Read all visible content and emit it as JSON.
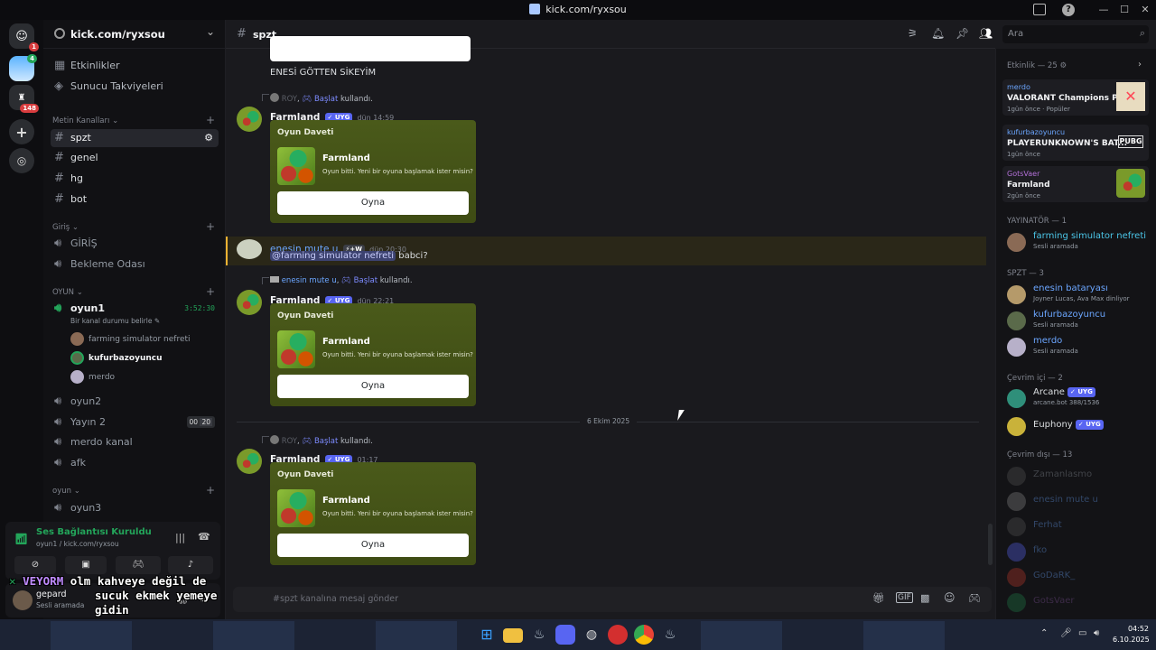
{
  "window": {
    "title": "kick.com/ryxsou",
    "min": "—",
    "max": "☐",
    "close": "✕"
  },
  "guild": {
    "name": "kick.com/ryxsou"
  },
  "sidebar_top": [
    "Etkinlikler",
    "Sunucu Takviyeleri"
  ],
  "categories": {
    "metin": "Metin Kanalları",
    "giris": "Giriş",
    "oyun_upper": "OYUN",
    "oyun_lower": "oyun"
  },
  "text_channels": [
    "spzt",
    "genel",
    "hg",
    "bot"
  ],
  "giris_channels": [
    "GİRİŞ",
    "Bekleme Odası"
  ],
  "voice": {
    "oyun1": {
      "name": "oyun1",
      "timer": "3:52:30",
      "status": "Bir kanal durumu belirle",
      "users": [
        "farming simulator nefreti",
        "kufurbazoyuncu",
        "merdo"
      ]
    },
    "others": [
      "oyun2",
      "Yayın 2",
      "merdo kanal",
      "afk"
    ],
    "yayin_counts": [
      "00",
      "20"
    ],
    "oyun3": "oyun3"
  },
  "voice_bar": {
    "title": "Ses Bağlantısı Kuruldu",
    "sub": "oyun1 / kick.com/ryxsou"
  },
  "user_panel": {
    "name": "gepard",
    "status": "Sesli aramada"
  },
  "stream_overlay": {
    "tag": "VEYORM",
    "line1": "olm kahveye değil de",
    "line2": "sucuk ekmek yemeye",
    "line3": "gidin"
  },
  "chat": {
    "channel": "spzt",
    "top_message": "ENESİ GÖTTEN SİKEYİM",
    "bot_name": "Farmland",
    "bot_tag": "UYG",
    "used_word": "kullandı.",
    "start_word": "Başlat",
    "embed_title": "Oyun Daveti",
    "game_title": "Farmland",
    "game_desc": "Oyun bitti. Yeni bir oyuna başlamak ister misin?",
    "play_label": "Oyna",
    "messages": [
      {
        "user": "ROY",
        "time": "dün 14:59"
      },
      {
        "user": "enesin mute u",
        "time": "dün 22:21"
      },
      {
        "user": "ROY",
        "time": "01:17"
      }
    ],
    "reply": {
      "user": "enesin mute u",
      "badge": "⚡+W",
      "time": "dün 20:30",
      "mention": "@farming simulator nefreti",
      "text": "babci?"
    },
    "date_divider": "6 Ekim 2025",
    "composer_placeholder": "#spzt kanalına mesaj gönder"
  },
  "search": {
    "placeholder": "Ara"
  },
  "members": {
    "activity_header": "Etkinlik — 25",
    "activities": [
      {
        "user": "merdo",
        "game": "VALORANT Champions Paris",
        "meta": "1gün önce",
        "meta2": "Popüler"
      },
      {
        "user": "kufurbazoyuncu",
        "game": "PLAYERUNKNOWN'S BAT...",
        "meta": "1gün önce",
        "meta2": ""
      },
      {
        "user": "GotsVaer",
        "game": "Farmland",
        "meta": "2gün önce",
        "meta2": ""
      }
    ],
    "yayinator_header": "YAYINATÖR — 1",
    "yayinator": [
      {
        "name": "farming simulator nefreti",
        "status": "Sesli aramada"
      }
    ],
    "spzt_header": "SPZT — 3",
    "spzt": [
      {
        "name": "enesin bataryası",
        "status": "Joyner Lucas, Ava Max dinliyor"
      },
      {
        "name": "kufurbazoyuncu",
        "status": "Sesli aramada"
      },
      {
        "name": "merdo",
        "status": "Sesli aramada"
      }
    ],
    "online_header": "Çevrim içi — 2",
    "online": [
      {
        "name": "Arcane",
        "tag": "UYG",
        "status": "arcane.bot 388/1536"
      },
      {
        "name": "Euphony",
        "tag": "UYG",
        "status": ""
      }
    ],
    "offline_header": "Çevrim dışı — 13",
    "offline": [
      "Zamanlasmo",
      "enesin mute u",
      "Ferhat",
      "fko",
      "GoDaRK_",
      "GotsVaer"
    ]
  },
  "taskbar": {
    "time": "04:52",
    "date": "6.10.2025"
  },
  "colors": {
    "accent": "#5865f2",
    "embed": "#4a5a1a",
    "mention": "#3c4270",
    "online": "#23a55a"
  }
}
